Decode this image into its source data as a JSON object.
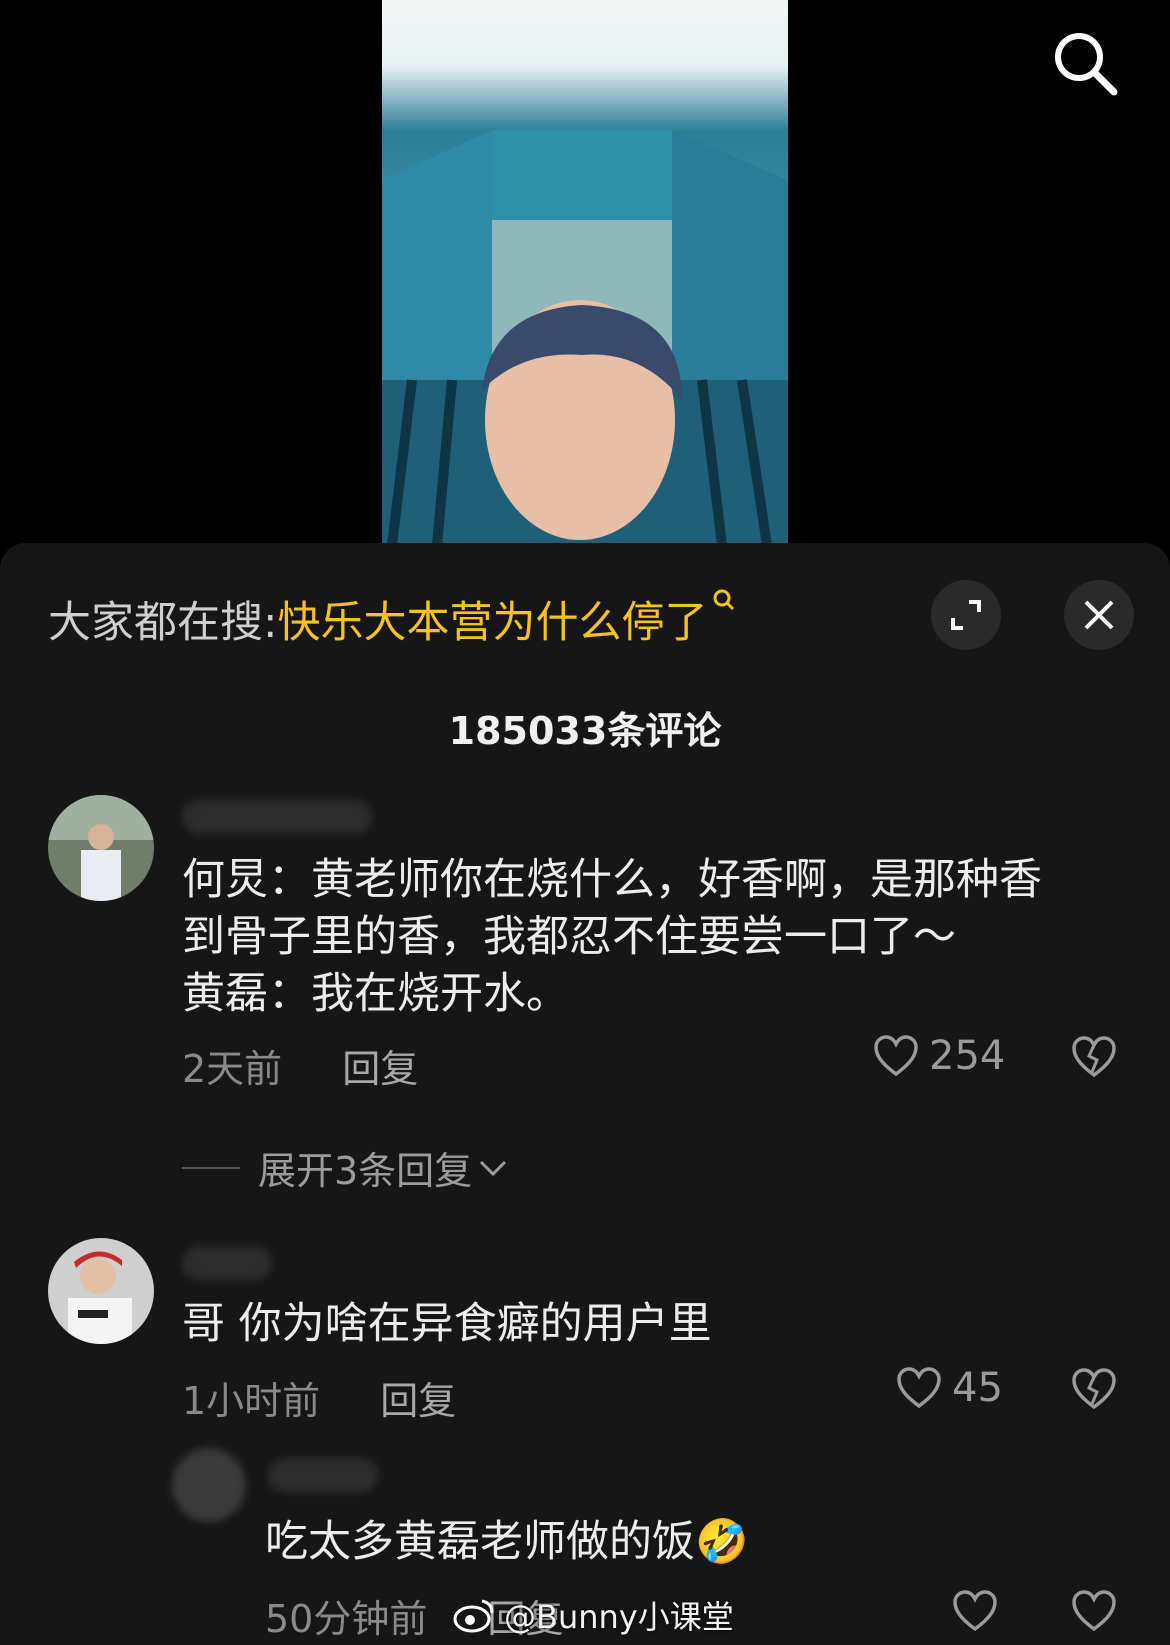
{
  "search_hint": {
    "prefix": "大家都在搜:",
    "term": "快乐大本营为什么停了"
  },
  "comment_count": "185033条评论",
  "comments": [
    {
      "text": "何炅：黄老师你在烧什么，好香啊，是那种香\n到骨子里的香，我都忍不住要尝一口了～\n黄磊：我在烧开水。",
      "time": "2天前",
      "reply_label": "回复",
      "likes": "254"
    },
    {
      "text": "哥 你为啥在异食癖的用户里",
      "time": "1小时前",
      "reply_label": "回复",
      "likes": "45"
    }
  ],
  "expand_label": "展开3条回复",
  "sub_reply": {
    "text": "吃太多黄磊老师做的饭",
    "emoji": "🤣",
    "time": "50分钟前",
    "reply_label": "回复"
  },
  "watermark": "@Bunny小课堂",
  "colors": {
    "accent": "#f7c21e",
    "panel_bg": "#161616"
  }
}
